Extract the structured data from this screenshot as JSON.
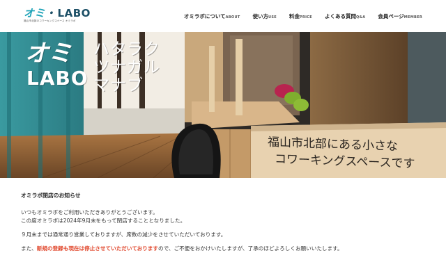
{
  "logo": {
    "main_jp": "オミ",
    "dot": "・",
    "main_en": "LABO",
    "subtitle": "福山市北部のコワーキングスペース オミラボ"
  },
  "nav": {
    "items": [
      {
        "jp": "オミラボについて",
        "en": "ABOUT"
      },
      {
        "jp": "使い方",
        "en": "USE"
      },
      {
        "jp": "料金",
        "en": "PRICE"
      },
      {
        "jp": "よくある質問",
        "en": "Q&A"
      },
      {
        "jp": "会員ページ",
        "en": "MEMBER"
      }
    ]
  },
  "hero": {
    "brand_line1": "オミ",
    "brand_line2": "LABO",
    "tagline": [
      "ハタラク",
      "ツナガル",
      "マナブ"
    ],
    "sign_line1": "福山市北部にある小さな",
    "sign_line2": "コワーキングスペースです"
  },
  "notice": {
    "title": "オミラボ閉店のお知らせ",
    "p1": "いつもオミラボをご利用いただきありがとうございます。",
    "p2": "この度オミラボは2024年9月末をもって閉店することとなりました。",
    "p3": "９月末までは通常通り営業しておりますが、席数の減少をさせていただいております。",
    "p4_pre": "また、",
    "p4_red": "新規の登録も現在は停止させていただいております",
    "p4_post": "ので、ご不便をおかけいたしますが、了承のほどよろしくお願いいたします。"
  }
}
